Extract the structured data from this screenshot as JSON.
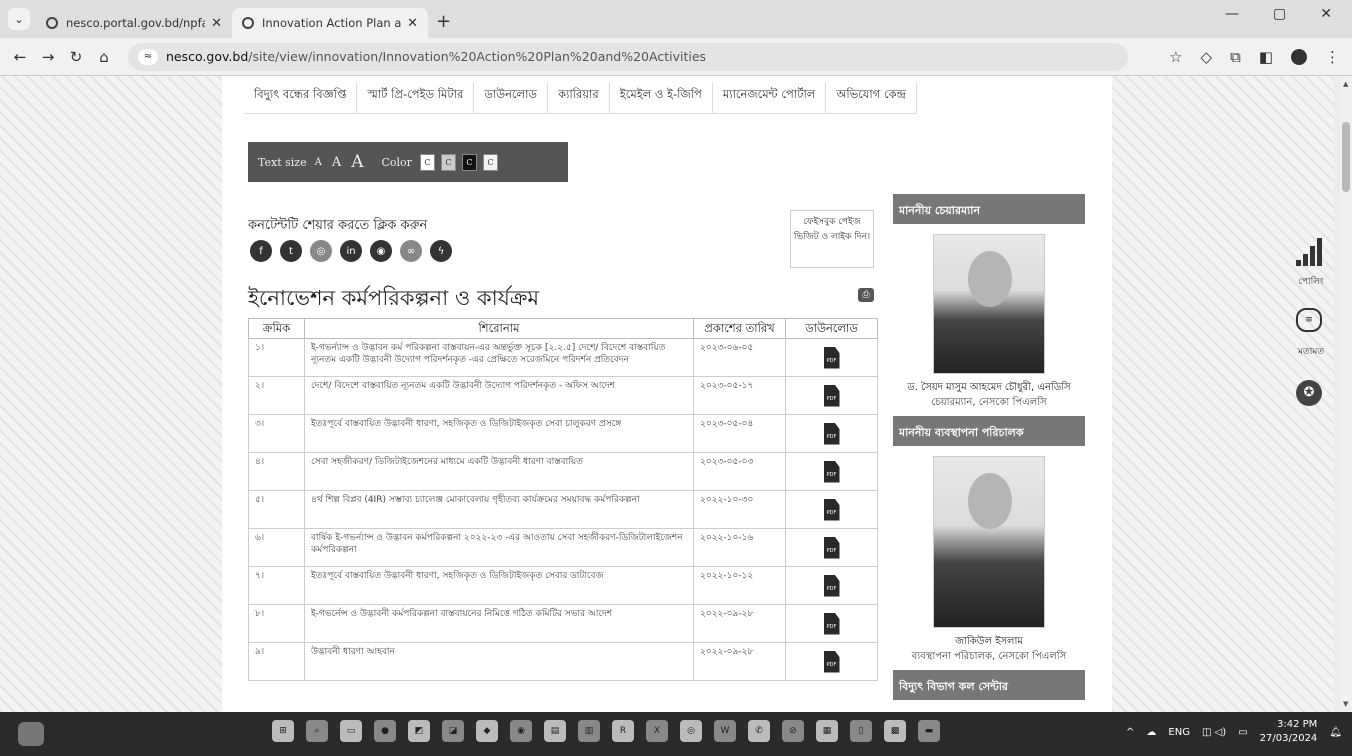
{
  "browser": {
    "tabs": [
      {
        "title": "nesco.portal.gov.bd/npfadmin/",
        "active": false
      },
      {
        "title": "Innovation Action Plan and Act",
        "active": true
      }
    ],
    "url_domain": "nesco.gov.bd",
    "url_path": "/site/view/innovation/Innovation%20Action%20Plan%20and%20Activities"
  },
  "menu": [
    "বিদ্যুৎ বন্ধের বিজ্ঞপ্তি",
    "স্মার্ট প্রি-পেইড মিটার",
    "ডাউনলোড",
    "ক্যারিয়ার",
    "ইমেইল ও ই-জিপি",
    "ম্যানেজমেন্ট পোর্টাল",
    "অভিযোগ কেন্দ্র"
  ],
  "accessibility": {
    "text_size_label": "Text size",
    "sizes": [
      "A",
      "A",
      "A"
    ],
    "color_label": "Color",
    "swatches": [
      "C",
      "C",
      "C",
      "C"
    ]
  },
  "share": {
    "label": "কনটেন্টটি শেয়ার করতে ক্লিক করুন",
    "fb_box": "ফেইসবুক পেইজ ভিজিট ও লাইক দিন।"
  },
  "page_title": "ইনোভেশন কর্মপরিকল্পনা ও কার্যক্রম",
  "table": {
    "headers": [
      "ক্রমিক",
      "শিরোনাম",
      "প্রকাশের তারিখ",
      "ডাউনলোড"
    ],
    "rows": [
      {
        "n": "১।",
        "title": "ই-গভর্ন্যান্স ও উদ্ভাবন কর্ম পরিকল্পনা বাস্তবায়ন-এর অন্তর্ভুক্ত সূচক [২.২.৫] দেশে/ বিদেশে বাস্তবায়িত ন্যূনতম একটি উদ্ভাবনী উদ্যোগ পরিদর্শনকৃত -এর প্রেক্ষিতে সরেজমিনে পরিদর্শন প্রতিবেদন",
        "date": "২০২৩-০৬-০৫"
      },
      {
        "n": "২।",
        "title": "দেশে/ বিদেশে বাস্তবায়িত ন্যূনতম একটি উদ্ভাবনী উদ্যোগ পরিদর্শনকৃত - অফিস আদেশ",
        "date": "২০২৩-০৫-১৭"
      },
      {
        "n": "৩।",
        "title": "ইতঃপূর্বে বাস্তবায়িত উদ্ভাবনী ধারণা, সহজিকৃত ও ডিজিটাইজকৃত সেবা চালুকরণ প্রসঙ্গে",
        "date": "২০২৩-০৫-০৪"
      },
      {
        "n": "৪।",
        "title": "সেবা সহজীকরণ/ ডিজিটাইজেশনের মাধ্যমে একটি উদ্ভাবনী ধারণা বাস্তবায়িত",
        "date": "২০২৩-০৫-০৩"
      },
      {
        "n": "৫।",
        "title": "৪র্থ শিল্প বিপ্লব (4IR) সম্ভাব্য চ্যালেঞ্জ মোকাবেলায় গৃহীতব্য কার্যক্রমের সময়াবদ্ধ কর্মপরিকল্পনা",
        "date": "২০২২-১০-৩০"
      },
      {
        "n": "৬।",
        "title": "বার্ষিক ই-গভর্ন্যান্স ও উদ্ভাবন কর্মপরিকল্পনা ২০২২-২৩ -এর আওতায় সেবা সহজীকরণ-ডিজিটালাইজেশন কর্মপরিকল্পনা",
        "date": "২০২২-১০-১৬"
      },
      {
        "n": "৭।",
        "title": "ইতঃপূর্বে বাস্তবায়িত উদ্ভাবনী ধারণা, সহজিকৃত ও ডিজিটাইজকৃত সেবার ডাটাবেজ",
        "date": "২০২২-১০-১২"
      },
      {
        "n": "৮।",
        "title": "ই-গভর্নেন্স ও উদ্ভাবনী কর্মপরিকল্পনা বাস্তবায়নের নিমিত্তে গঠিত কমিটির সভার আদেশ",
        "date": "২০২২-০৯-২৮"
      },
      {
        "n": "৯।",
        "title": "উদ্ভাবনী ধারণা আহবান",
        "date": "২০২২-০৯-২৮"
      }
    ],
    "pdf_label": "PDF"
  },
  "sidebar": {
    "chairman_head": "মাননীয় চেয়ারম্যান",
    "chairman_name": "ড. সৈয়দ মাসুম আহমেদ চৌধুরী, এনডিসি",
    "chairman_desig": "চেয়ারম্যান, নেসকো পিএলসি",
    "md_head": "মাননীয় ব্যবস্থাপনা পরিচালক",
    "md_name": "জাকিউল ইসলাম",
    "md_desig": "ব্যবস্থাপনা পরিচালক, নেসকো পিএলসি",
    "callcenter_head": "বিদ্যুৎ বিভাগ কল সেন্টার"
  },
  "floating": {
    "poll": "পোলিং",
    "feedback": "মতামত"
  },
  "taskbar": {
    "lang": "ENG",
    "time": "3:42 PM",
    "date": "27/03/2024"
  }
}
